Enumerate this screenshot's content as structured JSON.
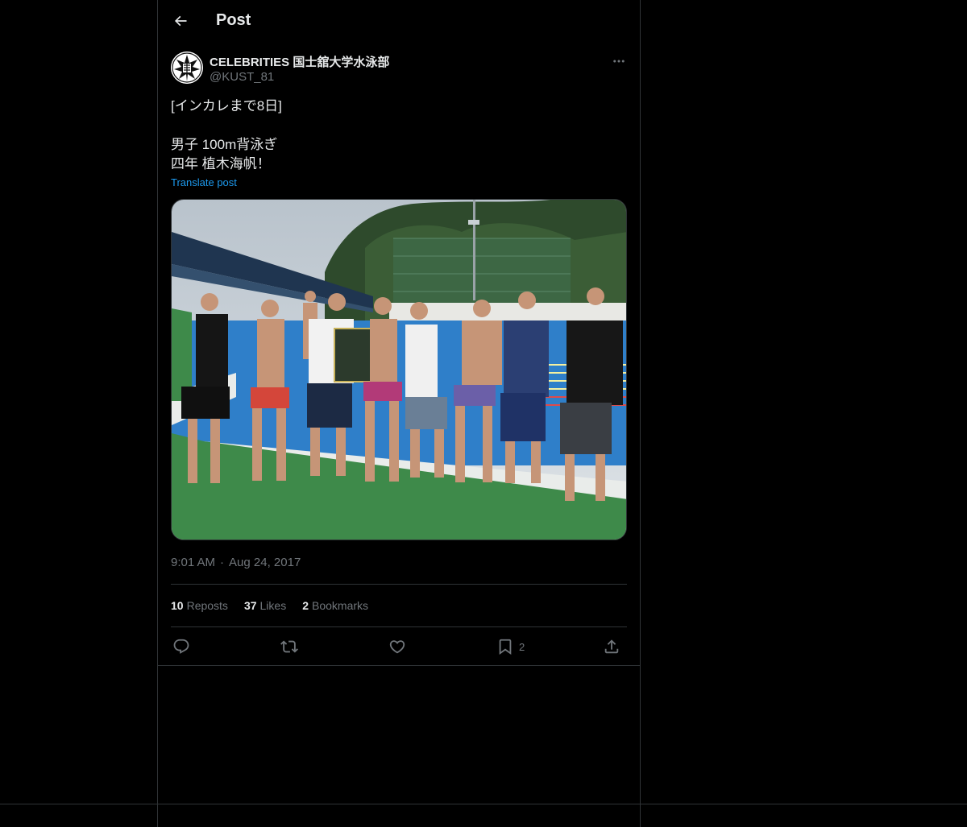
{
  "header": {
    "title": "Post",
    "back_icon": "arrow-left-icon"
  },
  "author": {
    "name": "CELEBRITIES 国士舘大学水泳部",
    "handle": "@KUST_81",
    "avatar_icon": "club-logo-avatar"
  },
  "post": {
    "lines": [
      "[インカレまで8日]",
      "",
      "男子 100m背泳ぎ",
      "四年 植木海帆！"
    ],
    "translate_label": "Translate post",
    "time": "9:01 AM",
    "separator": "·",
    "date": "Aug 24, 2017",
    "media_alt": "Swim team members posing by the pool"
  },
  "stats": {
    "reposts_count": "10",
    "reposts_label": "Reposts",
    "likes_count": "37",
    "likes_label": "Likes",
    "bookmarks_count": "2",
    "bookmarks_label": "Bookmarks"
  },
  "actions": {
    "reply_icon": "reply-icon",
    "repost_icon": "repost-icon",
    "like_icon": "heart-icon",
    "bookmark_icon": "bookmark-icon",
    "bookmark_count": "2",
    "share_icon": "share-icon"
  },
  "colors": {
    "background": "#000000",
    "text_primary": "#e7e9ea",
    "text_secondary": "#71767b",
    "link": "#1d9bf0",
    "border": "#2f3336"
  }
}
